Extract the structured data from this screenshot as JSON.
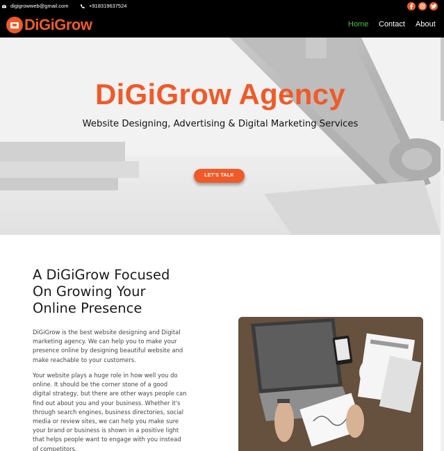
{
  "topbar": {
    "email": "digigrowweb@gmail.com",
    "phone": "+918319637524",
    "social_icons": [
      "facebook-icon",
      "instagram-icon",
      "twitter-icon"
    ],
    "social_color": "#f05a28"
  },
  "nav": {
    "logo_text": "DiGiGrow",
    "links": [
      {
        "label": "Home",
        "active": true
      },
      {
        "label": "Contact",
        "active": false
      },
      {
        "label": "About",
        "active": false
      }
    ]
  },
  "hero": {
    "title": "DiGiGrow Agency",
    "subtitle": "Website Designing, Advertising & Digital Marketing Services",
    "cta_label": "LET'S TALK"
  },
  "about": {
    "headline_lines": [
      "A DiGiGrow Focused",
      "On Growing Your",
      "Online Presence"
    ],
    "paragraph1_lines": [
      "DiGiGrow is the best website designing and Digital",
      "marketing agency. We can help you to make your",
      "presence online by designing beautiful website and",
      "make reachable to your customers."
    ],
    "paragraph2_lines": [
      "Your website plays a huge role in how well you do",
      "online. It should be the corner stone of a good",
      "digital strategy, but there are other ways people can",
      "find out about you and your business. Whether it's",
      "through search engines, business directories, social",
      "media or review sites, we can help you make sure",
      "your brand or business is shown in a positive light",
      "that helps people want to engage with you instead",
      "of competitors."
    ]
  },
  "colors": {
    "accent": "#f05a28",
    "nav_active": "#4fbf4a",
    "header_bg": "#000000"
  }
}
